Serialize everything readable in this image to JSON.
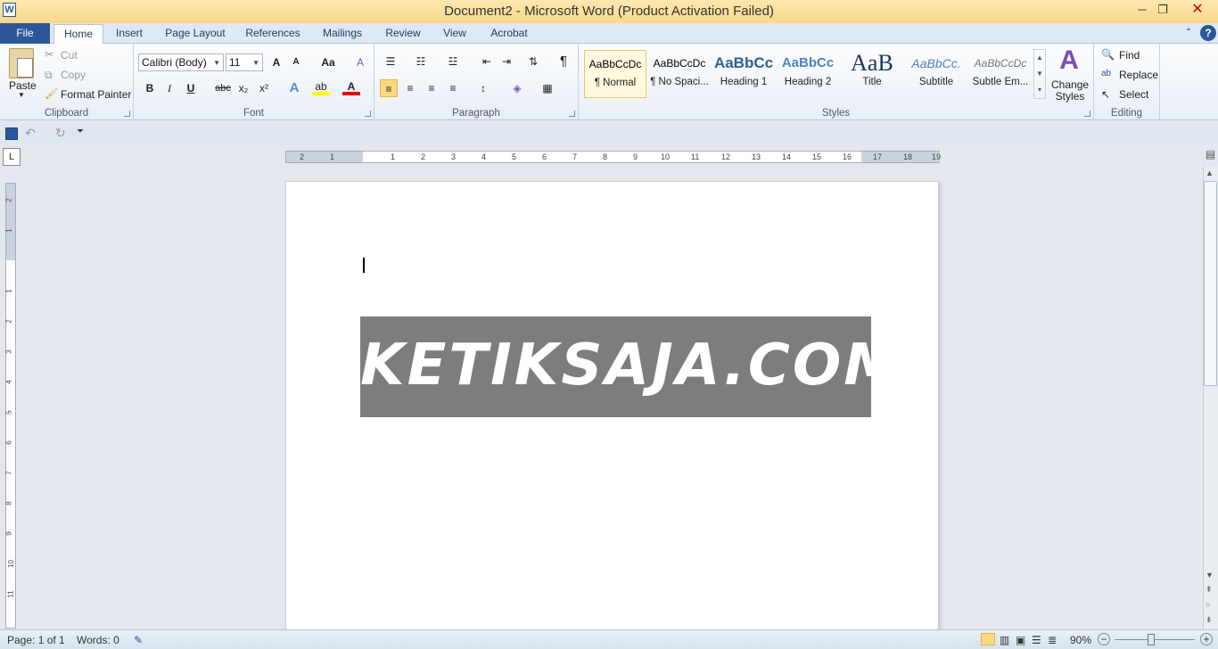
{
  "window": {
    "title": "Document2 - Microsoft Word (Product Activation Failed)",
    "app_icon": "W",
    "minimize_icon": "─",
    "restore_icon": "❐",
    "close_icon": "✕"
  },
  "tabs": [
    {
      "label": "File"
    },
    {
      "label": "Home"
    },
    {
      "label": "Insert"
    },
    {
      "label": "Page Layout"
    },
    {
      "label": "References"
    },
    {
      "label": "Mailings"
    },
    {
      "label": "Review"
    },
    {
      "label": "View"
    },
    {
      "label": "Acrobat"
    }
  ],
  "clipboard": {
    "paste": "Paste",
    "cut": "Cut",
    "copy": "Copy",
    "format_painter": "Format Painter",
    "label": "Clipboard"
  },
  "font": {
    "name": "Calibri (Body)",
    "size": "11",
    "label": "Font",
    "bold": "B",
    "italic": "I",
    "underline": "U",
    "strike": "abc",
    "sub": "x₂",
    "sup": "x²",
    "grow": "A",
    "shrink": "A",
    "case": "Aa",
    "clear": "A"
  },
  "paragraph": {
    "label": "Paragraph",
    "pilcrow": "¶"
  },
  "styles": {
    "label": "Styles",
    "items": [
      {
        "preview": "AaBbCcDc",
        "name": "¶ Normal"
      },
      {
        "preview": "AaBbCcDc",
        "name": "¶ No Spaci..."
      },
      {
        "preview": "AaBbCc",
        "name": "Heading 1"
      },
      {
        "preview": "AaBbCc",
        "name": "Heading 2"
      },
      {
        "preview": "AaB",
        "name": "Title"
      },
      {
        "preview": "AaBbCc.",
        "name": "Subtitle"
      },
      {
        "preview": "AaBbCcDc",
        "name": "Subtle Em..."
      }
    ],
    "change_styles": "Change Styles"
  },
  "editing": {
    "find": "Find",
    "replace": "Replace",
    "select": "Select",
    "label": "Editing"
  },
  "ruler": {
    "h_numbers": [
      "2",
      "1",
      "1",
      "2",
      "3",
      "4",
      "5",
      "6",
      "7",
      "8",
      "9",
      "10",
      "11",
      "12",
      "13",
      "14",
      "15",
      "16",
      "17",
      "18",
      "19"
    ],
    "v_numbers": [
      "2",
      "1",
      "1",
      "2",
      "3",
      "4",
      "5",
      "6",
      "7",
      "8",
      "9",
      "10",
      "11"
    ]
  },
  "document": {
    "logo_text": "KETIKSAJA.COM"
  },
  "status": {
    "page": "Page: 1 of 1",
    "words": "Words: 0",
    "zoom": "90%"
  },
  "colors": {
    "accent": "#2b579a",
    "title_bar": "#f9d88a"
  }
}
